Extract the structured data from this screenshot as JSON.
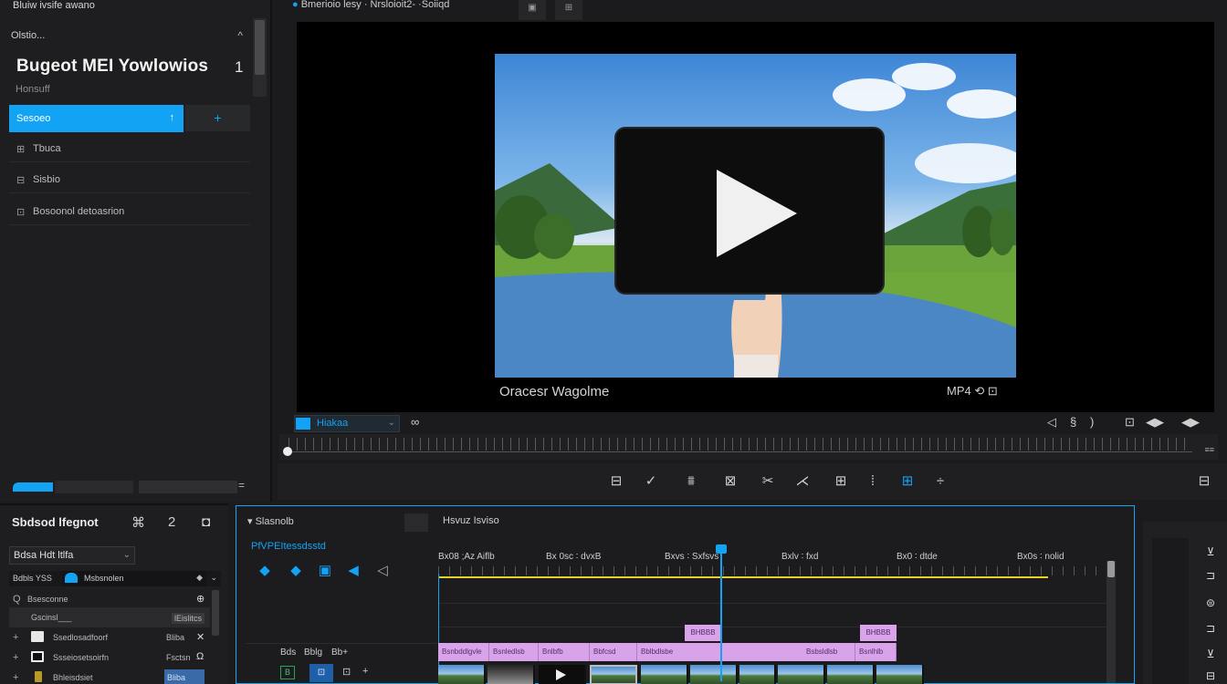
{
  "app": {
    "title": "Bluiw ivsife awano"
  },
  "left": {
    "header": "Olstio...",
    "header_chev": "^",
    "project_title": "Bugeot MEI Yowlowios",
    "project_count": "1",
    "project_sub": "Honsuff",
    "menu": [
      {
        "icon": "",
        "label": "Sesoeo",
        "arrow": "↑"
      },
      {
        "icon": "⊞",
        "label": "Tbuca"
      },
      {
        "icon": "⊟",
        "label": "Sisbio"
      },
      {
        "icon": "⊡",
        "label": "Bosoonol detoasrion"
      }
    ],
    "add_label": "+",
    "bottom_icon": "="
  },
  "viewer": {
    "tab_label": "Bmerioio lesy · Nrsloioit2- ·Soiiqd",
    "tab_dot": "●",
    "caption": "Oracesr Wagolme",
    "format": "MP4 ⟲ ⊡",
    "speed_label": "Hiakaa",
    "speed_dd": "⌄",
    "left_control": "∞",
    "right_controls": [
      "◁",
      "§",
      ")",
      "⊡",
      "◀▶",
      "◀▶"
    ],
    "ruler_end": "≡≡",
    "tools": [
      "⊟",
      "✓",
      "⩩",
      "⊠",
      "✂",
      "⋌",
      "⊞",
      "⁞",
      "⊞",
      "÷"
    ],
    "tool_right": "⊟"
  },
  "media_panel": {
    "title": "Sbdsod lfegnot",
    "icons": [
      "⌘",
      "2",
      "◘"
    ],
    "select": "Bdsa Hdt ltlfa",
    "select_dd": "⌄",
    "filter_left": "Bdbls YSS",
    "filter_text": "Msbsnolen",
    "filter_right": "◆",
    "filter_end": "⌄",
    "rows": [
      {
        "plus": "Q",
        "name": "Bsesconne",
        "right": "⊕"
      },
      {
        "plus": "",
        "name": "Gscinsl___",
        "right": "lEislitcs"
      },
      {
        "plus": "+",
        "name": "Ssedlosadfoorf",
        "right": "Bliba",
        "icon": "✕"
      },
      {
        "plus": "+",
        "name": "Ssseiosetsoirfn",
        "right": "Fsctsn",
        "icon": "Ω"
      },
      {
        "plus": "+",
        "name": "Bhleisdsiet",
        "right": "Bliba"
      }
    ]
  },
  "timeline": {
    "head_label": "▾ Slasnolb",
    "tab_label": "Hsvuz  Isviso",
    "blue_label": "PfVPEItessdsstd",
    "buttons": [
      "◆",
      "◆",
      "▣",
      "◀",
      "◁"
    ],
    "track_header": [
      "Bds",
      "Bblg",
      "Bb+"
    ],
    "track_ctrls": {
      "green": "B",
      "blue": "⊡",
      "w1": "⊡",
      "w2": "+"
    },
    "ruler_labels": [
      "Bx08 ;Az Aiflb",
      "Bx 0sc ∶ dvxB",
      "Bxvs ∶ Sxfsvs",
      "Bxlv ∶ fxd",
      "Bx0 ∶ dtde",
      "Bx0s ∶ nolid"
    ],
    "clips": [
      {
        "label": "Bsnbddlgvle"
      },
      {
        "label": "Bsnledlsb"
      },
      {
        "label": "Bnlbfb"
      },
      {
        "label": "Bbfcsd"
      },
      {
        "label": "Bblbdlsbe"
      },
      {
        "label": "Bsbsldlsb"
      },
      {
        "label": "Bsnlhlb"
      }
    ],
    "tags": [
      "BHBBB",
      "BHBBB"
    ]
  },
  "right_icons": [
    "⊻",
    "⊐",
    "⊜",
    "⊐",
    "⊻",
    "⊟"
  ],
  "colors": {
    "accent": "#13a3f4",
    "clip": "#d9a3ea",
    "playhead": "#13a3f4",
    "range": "#e7d22a"
  }
}
